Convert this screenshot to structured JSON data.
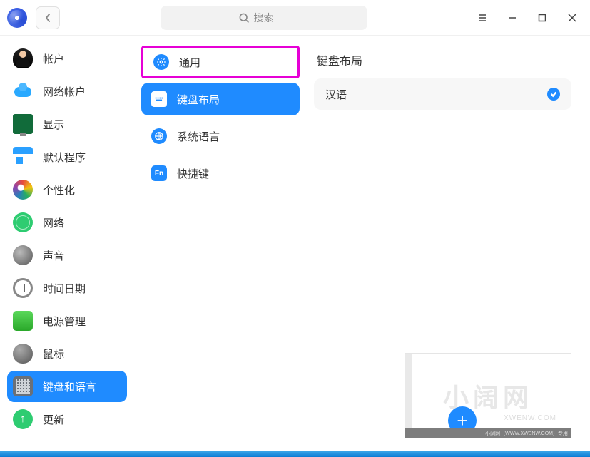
{
  "header": {
    "search_placeholder": "搜索"
  },
  "sidebar": {
    "items": [
      {
        "label": "帐户"
      },
      {
        "label": "网络帐户"
      },
      {
        "label": "显示"
      },
      {
        "label": "默认程序"
      },
      {
        "label": "个性化"
      },
      {
        "label": "网络"
      },
      {
        "label": "声音"
      },
      {
        "label": "时间日期"
      },
      {
        "label": "电源管理"
      },
      {
        "label": "鼠标"
      },
      {
        "label": "键盘和语言"
      },
      {
        "label": "更新"
      }
    ],
    "active_index": 10
  },
  "subpanel": {
    "items": [
      {
        "label": "通用"
      },
      {
        "label": "键盘布局"
      },
      {
        "label": "系统语言"
      },
      {
        "label": "快捷键"
      }
    ],
    "active_index": 1,
    "highlighted_index": 0
  },
  "content": {
    "title": "键盘布局",
    "layouts": [
      {
        "label": "汉语",
        "selected": true
      }
    ]
  },
  "watermark": {
    "main": "小阔网",
    "sub": "XWENW.COM",
    "footer": "小阔网（WWW.XWENW.COM）专用"
  }
}
